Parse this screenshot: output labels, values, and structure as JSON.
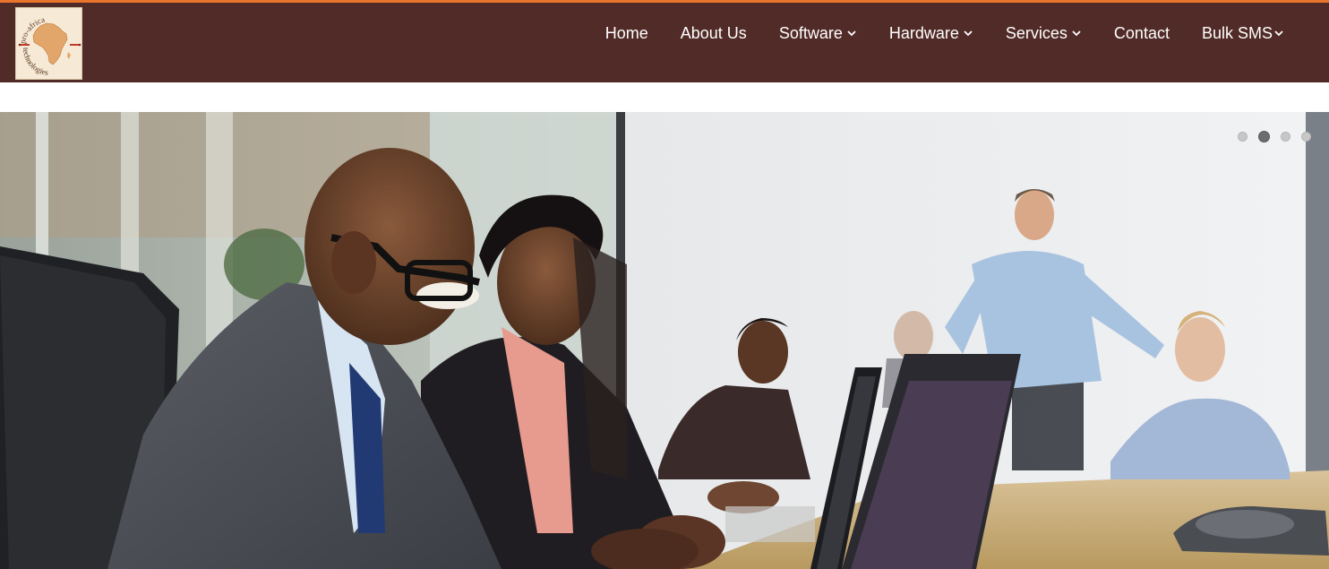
{
  "brand": {
    "logo_text_top": "pro-africa",
    "logo_text_bottom": "technologies",
    "header_color": "#512b27",
    "accent_color": "#e9742b"
  },
  "nav": {
    "items": [
      {
        "label": "Home",
        "dropdown": false
      },
      {
        "label": "About Us",
        "dropdown": false
      },
      {
        "label": "Software",
        "dropdown": true
      },
      {
        "label": "Hardware",
        "dropdown": true
      },
      {
        "label": "Services",
        "dropdown": true
      },
      {
        "label": "Contact",
        "dropdown": false
      },
      {
        "label": "Bulk SMS",
        "dropdown": true
      }
    ]
  },
  "slider": {
    "slide_count": 4,
    "active_index": 1,
    "image": "office meeting with people working on laptops"
  }
}
